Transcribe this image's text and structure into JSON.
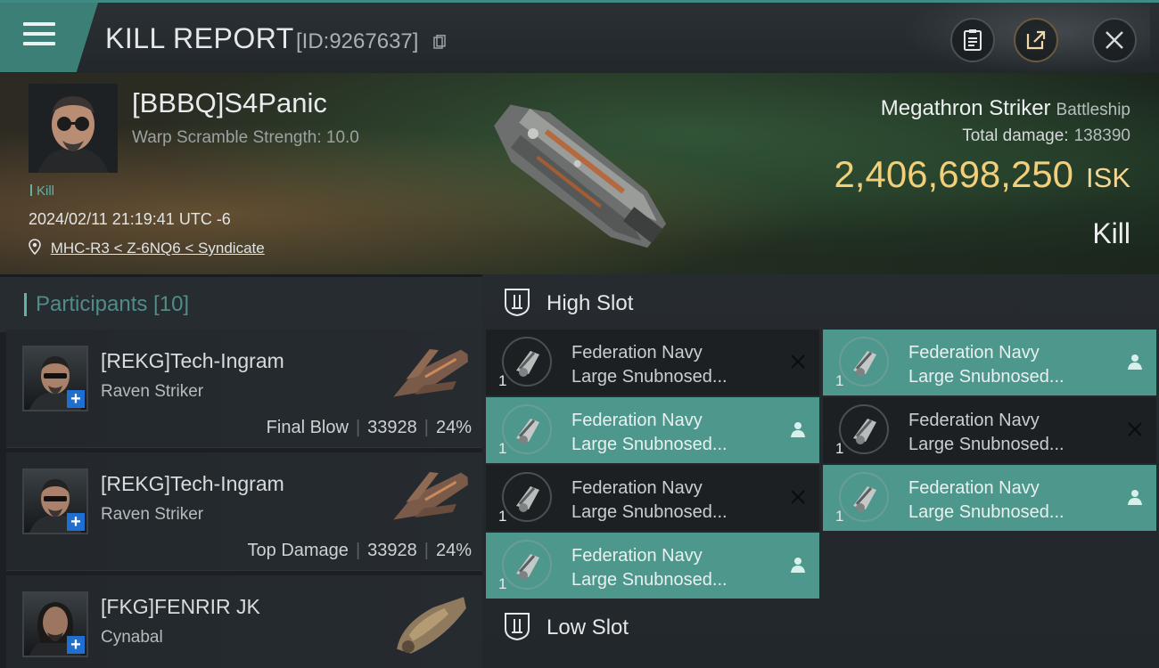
{
  "header": {
    "title": "KILL REPORT",
    "report_id": "[ID:9267637]",
    "icons": [
      "menu-icon",
      "copy-icon",
      "clipboard-icon",
      "share-icon",
      "close-icon"
    ]
  },
  "victim": {
    "name": "[BBBQ]S4Panic",
    "warp_scramble": "Warp Scramble Strength: 10.0",
    "kill_tag": "Kill",
    "datetime": "2024/02/11 21:19:41 UTC -6",
    "location": "MHC-R3 < Z-6NQ6 < Syndicate",
    "ship_name": "Megathron Striker",
    "ship_class": "Battleship",
    "total_damage_label": "Total damage:",
    "total_damage_value": "138390",
    "isk_value": "2,406,698,250",
    "isk_unit": "ISK",
    "result": "Kill"
  },
  "participants": {
    "label": "Participants [10]",
    "items": [
      {
        "name": "[REKG]Tech-Ingram",
        "ship": "Raven Striker",
        "role": "Final Blow",
        "damage": "33928",
        "percent": "24%"
      },
      {
        "name": "[REKG]Tech-Ingram",
        "ship": "Raven Striker",
        "role": "Top Damage",
        "damage": "33928",
        "percent": "24%"
      },
      {
        "name": "[FKG]FENRIR JK",
        "ship": "Cynabal",
        "role": "",
        "damage": "",
        "percent": ""
      }
    ]
  },
  "fittings": {
    "high_slot": {
      "title": "High Slot",
      "modules": [
        {
          "line1": "Federation Navy",
          "line2": "Large Snubnosed...",
          "qty": "1",
          "state": "destroyed"
        },
        {
          "line1": "Federation Navy",
          "line2": "Large Snubnosed...",
          "qty": "1",
          "state": "dropped"
        },
        {
          "line1": "Federation Navy",
          "line2": "Large Snubnosed...",
          "qty": "1",
          "state": "dropped"
        },
        {
          "line1": "Federation Navy",
          "line2": "Large Snubnosed...",
          "qty": "1",
          "state": "destroyed"
        },
        {
          "line1": "Federation Navy",
          "line2": "Large Snubnosed...",
          "qty": "1",
          "state": "destroyed"
        },
        {
          "line1": "Federation Navy",
          "line2": "Large Snubnosed...",
          "qty": "1",
          "state": "dropped"
        },
        {
          "line1": "Federation Navy",
          "line2": "Large Snubnosed...",
          "qty": "1",
          "state": "dropped"
        }
      ]
    },
    "low_slot": {
      "title": "Low Slot"
    }
  },
  "colors": {
    "accent": "#4e978c",
    "isk": "#f3cf79",
    "plus_badge": "#1f6fd0"
  }
}
